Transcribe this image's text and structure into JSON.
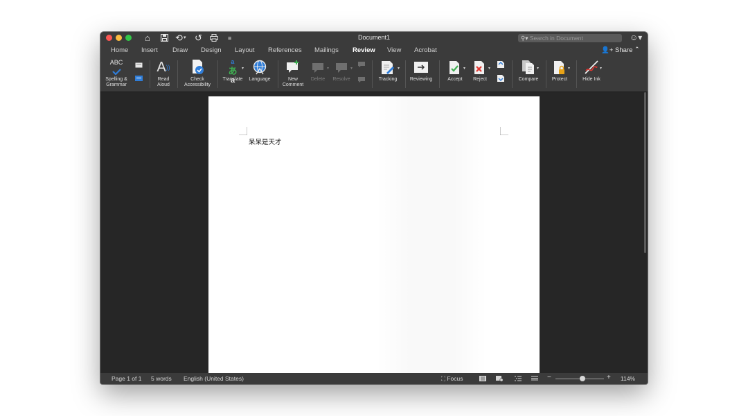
{
  "window": {
    "title": "Document1",
    "search_placeholder": "Search in Document"
  },
  "tabs": [
    "Home",
    "Insert",
    "Draw",
    "Design",
    "Layout",
    "References",
    "Mailings",
    "Review",
    "View",
    "Acrobat"
  ],
  "active_tab": "Review",
  "share_label": "Share",
  "ribbon": {
    "spelling_grammar_label": "Spelling &\nGrammar",
    "read_aloud_label": "Read\nAloud",
    "check_accessibility_label": "Check\nAccessibility",
    "translate_label": "Translate",
    "language_label": "Language",
    "new_comment_label": "New\nComment",
    "delete_label": "Delete",
    "resolve_label": "Resolve",
    "tracking_label": "Tracking",
    "reviewing_label": "Reviewing",
    "accept_label": "Accept",
    "reject_label": "Reject",
    "compare_label": "Compare",
    "protect_label": "Protect",
    "hide_ink_label": "Hide Ink",
    "abc_icon_text": "ABC"
  },
  "document": {
    "body_text": "呆呆是天才"
  },
  "statusbar": {
    "page": "Page 1 of 1",
    "words": "5 words",
    "language": "English (United States)",
    "focus": "Focus",
    "zoom_minus": "−",
    "zoom_plus": "+",
    "zoom_level": "114%",
    "zoom_fraction": 0.56
  },
  "colors": {
    "chrome": "#3b3b3b",
    "background": "#262626",
    "accent_blue": "#2f7dd8",
    "reject_red": "#e0352f"
  }
}
